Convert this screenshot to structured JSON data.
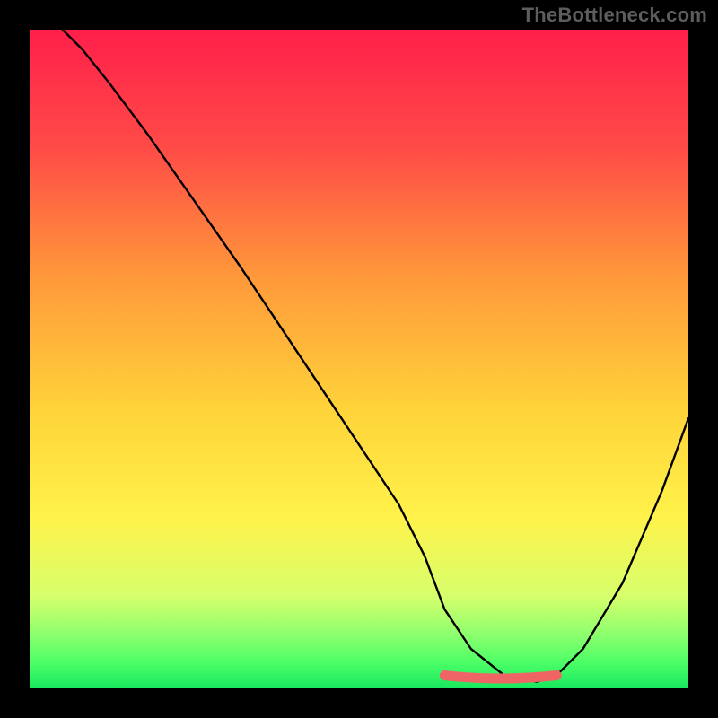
{
  "watermark": "TheBottleneck.com",
  "colors": {
    "frame": "#000000",
    "curve": "#000000",
    "accent": "#ef6565",
    "grad_top": "#ff1f4a",
    "grad_mid1": "#ff7a3d",
    "grad_mid2": "#ffe13a",
    "grad_low1": "#fff95a",
    "grad_low2": "#d7ff6c",
    "grad_green1": "#6eff70",
    "grad_green2": "#2dff67",
    "grad_green3": "#18e85f"
  },
  "chart_data": {
    "type": "line",
    "title": "",
    "xlabel": "",
    "ylabel": "",
    "xlim": [
      0,
      100
    ],
    "ylim": [
      0,
      100
    ],
    "series": [
      {
        "name": "bottleneck-curve",
        "x": [
          5,
          8,
          12,
          18,
          25,
          32,
          40,
          48,
          56,
          60,
          63,
          67,
          72,
          77,
          80,
          84,
          90,
          96,
          100
        ],
        "y": [
          100,
          97,
          92,
          84,
          74,
          64,
          52,
          40,
          28,
          20,
          12,
          6,
          2,
          1,
          2,
          6,
          16,
          30,
          41
        ]
      }
    ],
    "flat_region": {
      "x_start": 63,
      "x_end": 80,
      "y": 1.5
    },
    "gradient_stops": [
      {
        "offset": 0.0,
        "color": "#ff1f4a"
      },
      {
        "offset": 0.18,
        "color": "#ff4b47"
      },
      {
        "offset": 0.38,
        "color": "#ff9a3a"
      },
      {
        "offset": 0.58,
        "color": "#ffd43a"
      },
      {
        "offset": 0.74,
        "color": "#fff24a"
      },
      {
        "offset": 0.86,
        "color": "#d7ff6c"
      },
      {
        "offset": 0.92,
        "color": "#8bff6e"
      },
      {
        "offset": 0.96,
        "color": "#4dff67"
      },
      {
        "offset": 1.0,
        "color": "#18e85f"
      }
    ]
  },
  "layout": {
    "outer_w": 800,
    "outer_h": 800,
    "inner_x": 33,
    "inner_y": 33,
    "inner_w": 734,
    "inner_h": 734
  }
}
